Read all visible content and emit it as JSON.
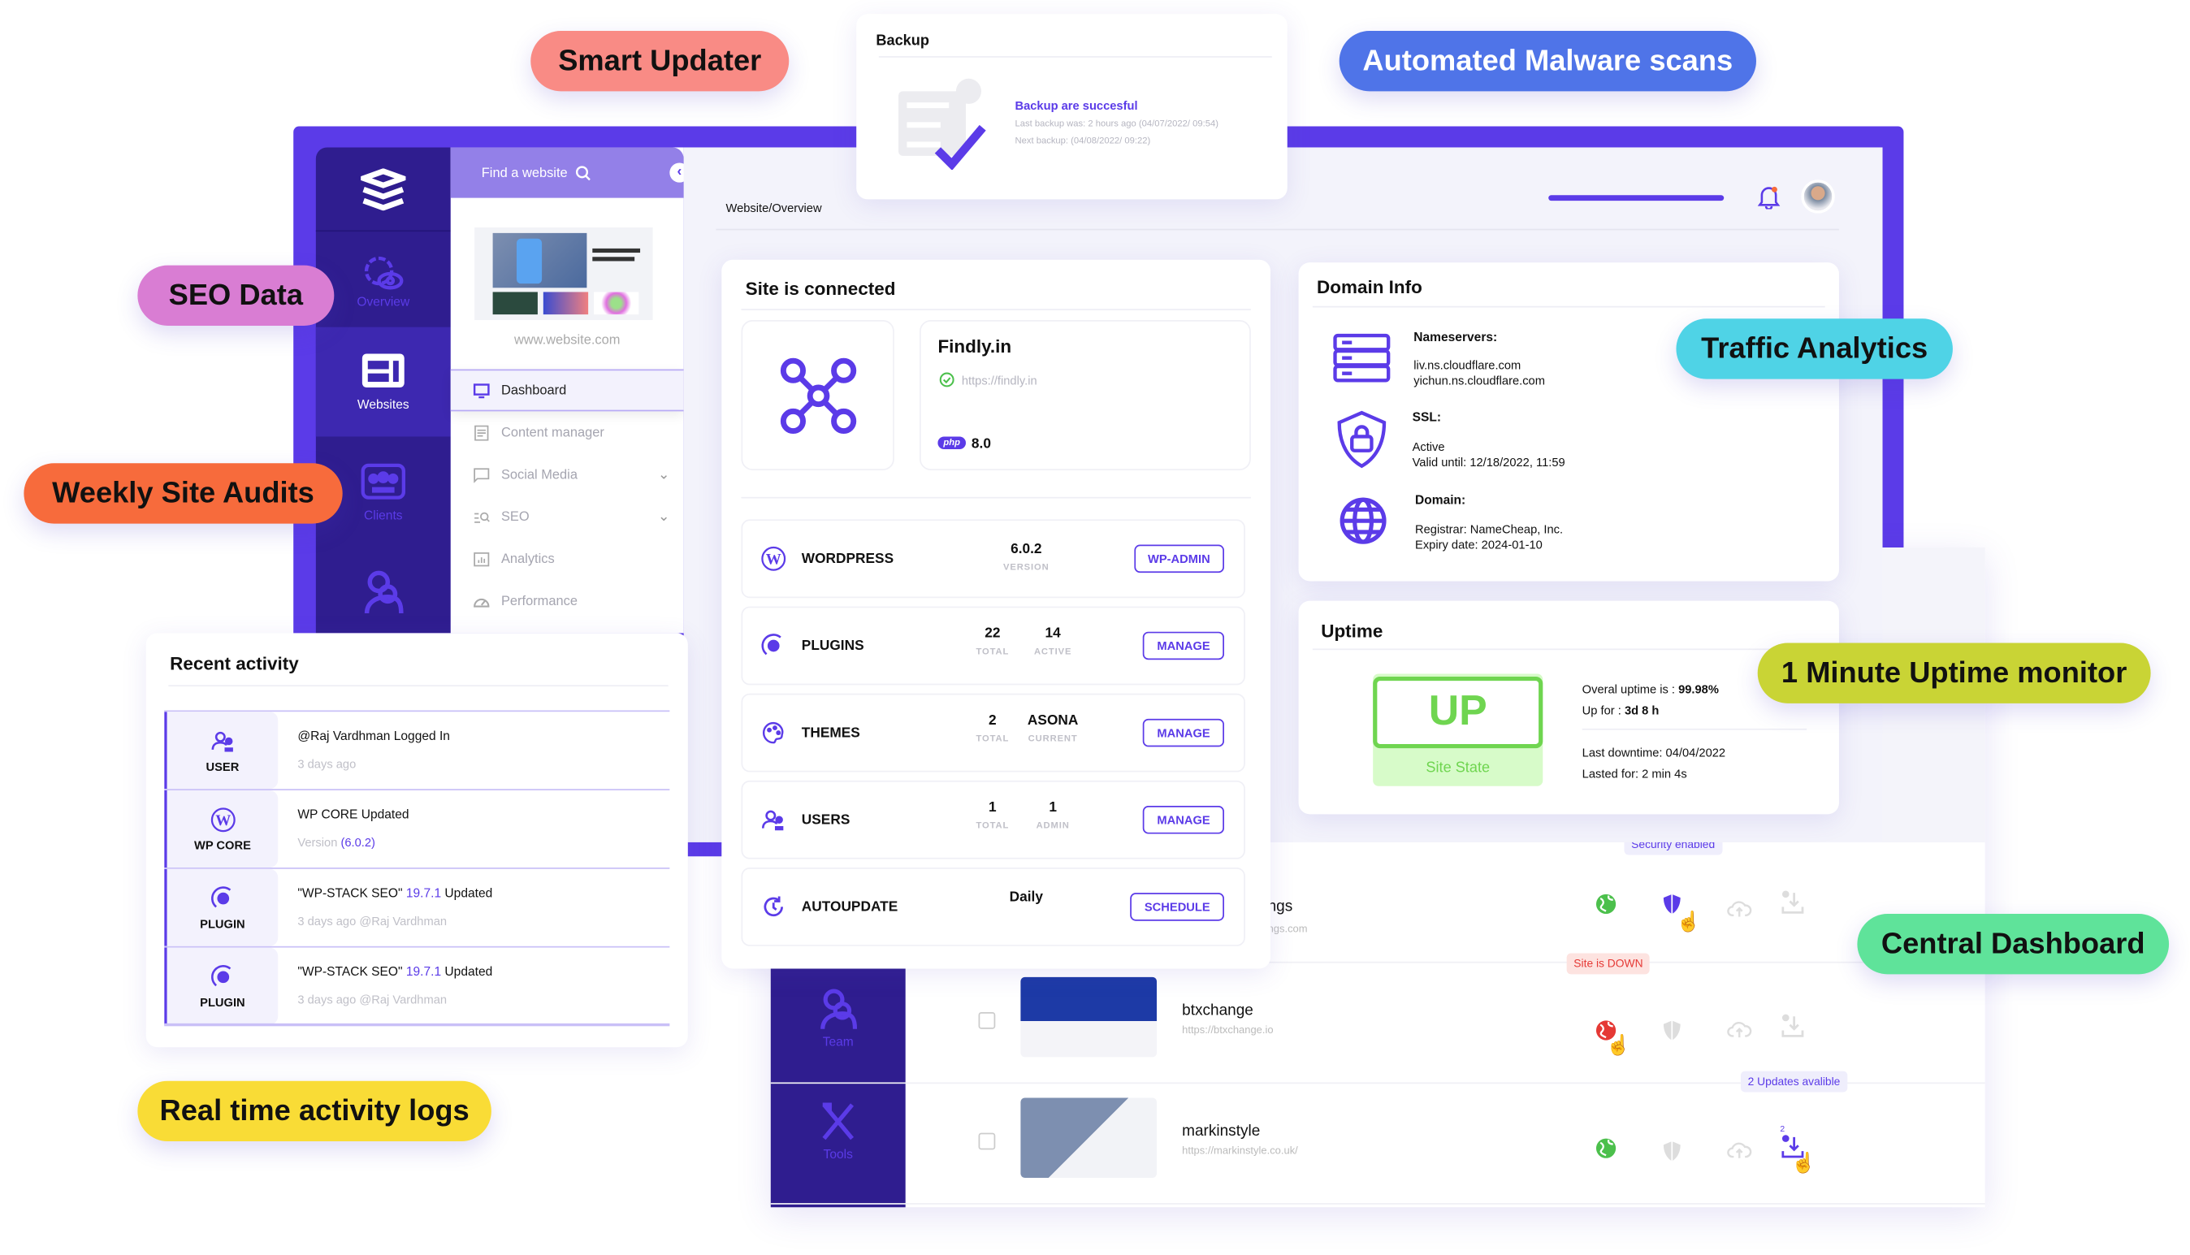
{
  "colors": {
    "accent": "#5b3be8",
    "sidebar_dark": "#2f1d8f",
    "success": "#6fd550",
    "danger": "#e53935"
  },
  "feature_pills": [
    {
      "label": "Smart Updater",
      "color": "#f98b85"
    },
    {
      "label": "Automated Malware scans",
      "color": "#4f74e8"
    },
    {
      "label": "SEO Data",
      "color": "#d97dd3"
    },
    {
      "label": "Traffic Analytics",
      "color": "#4fd3e6"
    },
    {
      "label": "Weekly Site Audits",
      "color": "#f76b3c"
    },
    {
      "label": "1 Minute Uptime monitor",
      "color": "#c9d435"
    },
    {
      "label": "Central Dashboard",
      "color": "#5fe39a"
    },
    {
      "label": "Real time activity logs",
      "color": "#f9dc36"
    }
  ],
  "backup": {
    "title": "Backup",
    "status": "Backup are succesful",
    "last_label": "Last backup was:",
    "last_value": "2 hours ago (04/07/2022/ 09:54)",
    "next_label": "Next backup:",
    "next_value": "(04/08/2022/ 09:22)"
  },
  "sidebar": {
    "items": [
      {
        "label": "Overview",
        "icon": "gear-eye-icon"
      },
      {
        "label": "Websites",
        "icon": "layout-icon",
        "active": true
      },
      {
        "label": "Clients",
        "icon": "group-icon"
      },
      {
        "label": "Team",
        "icon": "team-icon"
      }
    ]
  },
  "nav": {
    "search_placeholder": "Find a website",
    "site_url": "www.website.com",
    "items": [
      {
        "label": "Dashboard",
        "active": true
      },
      {
        "label": "Content manager"
      },
      {
        "label": "Social Media",
        "expandable": true
      },
      {
        "label": "SEO",
        "expandable": true
      },
      {
        "label": "Analytics"
      },
      {
        "label": "Performance"
      }
    ]
  },
  "header": {
    "breadcrumb": "Website/Overview"
  },
  "site": {
    "title": "Site is connected",
    "name": "Findly.in",
    "url": "https://findly.in",
    "php_badge": "php",
    "php_version": "8.0",
    "rows": [
      {
        "label": "WORDPRESS",
        "values": [
          {
            "v": "6.0.2",
            "k": "VERSION"
          }
        ],
        "button": "WP-ADMIN"
      },
      {
        "label": "PLUGINS",
        "values": [
          {
            "v": "22",
            "k": "TOTAL"
          },
          {
            "v": "14",
            "k": "ACTIVE"
          }
        ],
        "button": "MANAGE"
      },
      {
        "label": "THEMES",
        "values": [
          {
            "v": "2",
            "k": "TOTAL"
          },
          {
            "v": "ASONA",
            "k": "CURRENT"
          }
        ],
        "button": "MANAGE"
      },
      {
        "label": "USERS",
        "values": [
          {
            "v": "1",
            "k": "TOTAL"
          },
          {
            "v": "1",
            "k": "ADMIN"
          }
        ],
        "button": "MANAGE"
      },
      {
        "label": "AUTOUPDATE",
        "values": [
          {
            "v": "Daily",
            "k": ""
          }
        ],
        "button": "SCHEDULE"
      }
    ]
  },
  "domain": {
    "title": "Domain Info",
    "ns_label": "Nameservers:",
    "ns1": "liv.ns.cloudflare.com",
    "ns2": "yichun.ns.cloudflare.com",
    "ssl_label": "SSL:",
    "ssl_status": "Active",
    "ssl_valid": "Valid until: 12/18/2022, 11:59",
    "domain_label": "Domain:",
    "registrar": "Registrar: NameCheap, Inc.",
    "expiry": "Expiry date: 2024-01-10"
  },
  "uptime": {
    "title": "Uptime",
    "state": "UP",
    "state_label": "Site State",
    "overall_label": "Overal uptime is :",
    "overall_value": "99.98%",
    "upfor_label": "Up for :",
    "upfor_value": "3d 8 h",
    "last_downtime": "Last downtime: 04/04/2022",
    "lasted": "Lasted for: 2 min 4s"
  },
  "activity": {
    "title": "Recent activity",
    "items": [
      {
        "type": "USER",
        "text": "@Raj Vardhman Logged In",
        "hl": "",
        "after": "",
        "sub": "3 days ago",
        "sub_hl": ""
      },
      {
        "type": "WP CORE",
        "text": "WP CORE Updated",
        "hl": "",
        "after": "",
        "sub": "Version ",
        "sub_hl": "(6.0.2)"
      },
      {
        "type": "PLUGIN",
        "text": "\"WP-STACK SEO\" ",
        "hl": "19.7.1",
        "after": " Updated",
        "sub": "3 days ago @Raj Vardhman",
        "sub_hl": ""
      },
      {
        "type": "PLUGIN",
        "text": "\"WP-STACK SEO\" ",
        "hl": "19.7.1",
        "after": " Updated",
        "sub": "3 days ago @Raj Vardhman",
        "sub_hl": ""
      }
    ]
  },
  "websites": {
    "sidebar": [
      {
        "label": "Team"
      },
      {
        "label": "Tools"
      }
    ],
    "rows": [
      {
        "name": "ngs",
        "url": "ngs.com",
        "tooltip": "Security enabled",
        "status": "up"
      },
      {
        "name": "btxchange",
        "url": "https://btxchange.io",
        "tooltip": "Site is DOWN",
        "status": "down"
      },
      {
        "name": "markinstyle",
        "url": "https://markinstyle.co.uk/",
        "tooltip": "2 Updates avalible",
        "status": "up",
        "updates": "2"
      }
    ]
  }
}
